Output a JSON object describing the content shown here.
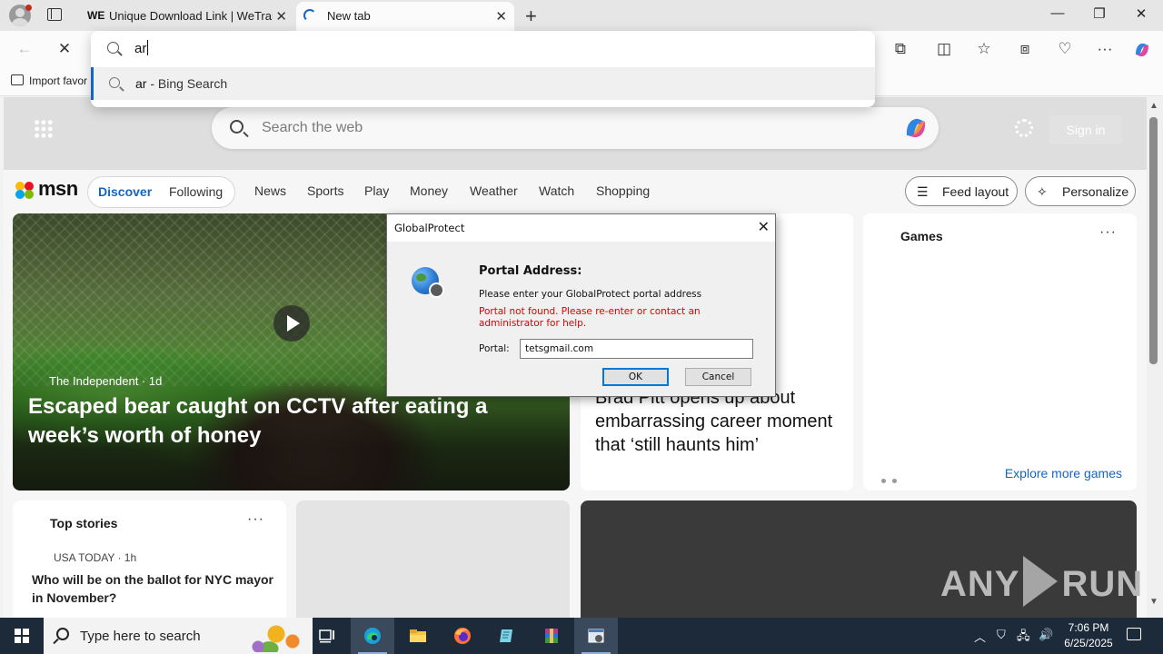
{
  "browser": {
    "tabs": [
      {
        "title": "Unique Download Link | WeTransfer",
        "favicon": "WE",
        "active": false
      },
      {
        "title": "New tab",
        "active": true
      }
    ],
    "favorites_bar": {
      "import_label": "Import favor"
    }
  },
  "omnibox": {
    "query": "ar",
    "suggestion_prefix": "ar",
    "suggestion_suffix": " - Bing Search"
  },
  "msn": {
    "search_placeholder": "Search the web",
    "sign_in": "Sign in",
    "logo": "msn",
    "tabs": {
      "discover": "Discover",
      "following": "Following"
    },
    "nav": [
      "News",
      "Sports",
      "Play",
      "Money",
      "Weather",
      "Watch",
      "Shopping"
    ],
    "feed_layout": "Feed layout",
    "personalize": "Personalize",
    "hero": {
      "source": "The Independent · 1d",
      "headline": "Escaped bear caught on CCTV after eating a week’s worth of honey"
    },
    "mid_card": {
      "headline": "Brad Pitt opens up about embarrassing career moment that ‘still haunts him’"
    },
    "games": {
      "title": "Games",
      "explore": "Explore more games",
      "more": "···"
    },
    "top_stories": {
      "title": "Top stories",
      "more": "···",
      "source": "USA TODAY · 1h",
      "headline": "Who will be on the ballot for NYC mayor in November?"
    },
    "watermark": {
      "left": "ANY",
      "right": "RUN"
    }
  },
  "dialog": {
    "title": "GlobalProtect",
    "heading": "Portal Address:",
    "message": "Please enter your GlobalProtect portal address",
    "error": "Portal not found. Please re-enter or contact an administrator for help.",
    "portal_label": "Portal:",
    "portal_value": "tetsgmail.com",
    "ok": "OK",
    "cancel": "Cancel"
  },
  "taskbar": {
    "search_placeholder": "Type here to search",
    "time": "7:06 PM",
    "date": "6/25/2025"
  },
  "colors": {
    "accent": "#1466c4",
    "error": "#e00000",
    "taskbar": "#1c2a3a"
  }
}
